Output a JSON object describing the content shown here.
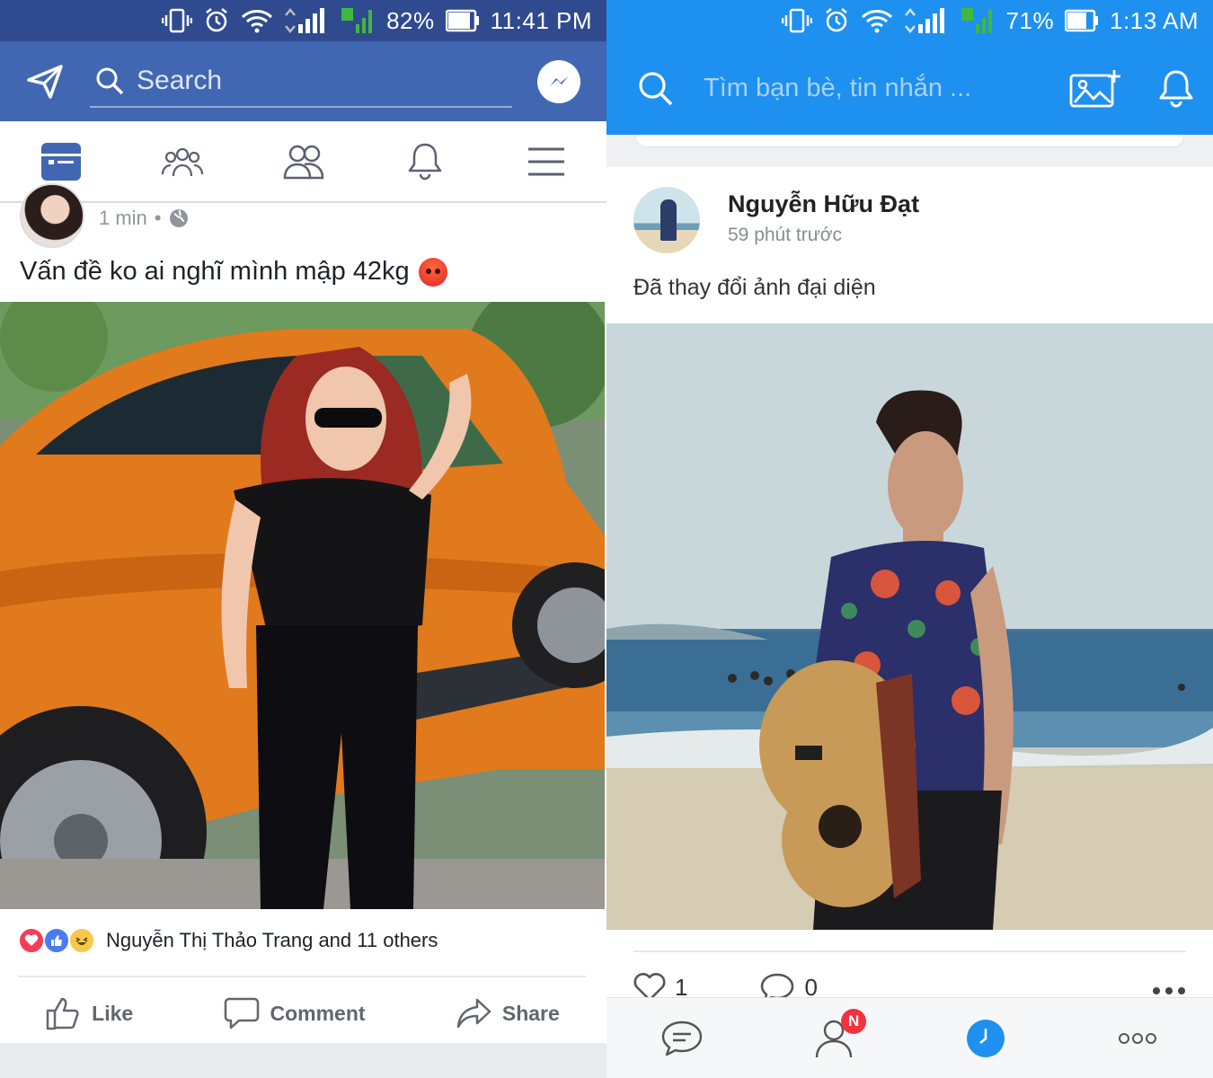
{
  "left": {
    "status": {
      "battery": "82%",
      "time": "11:41 PM",
      "sim_label": "2"
    },
    "header": {
      "search_placeholder": "Search"
    },
    "post": {
      "time": "1 min",
      "separator": "•",
      "caption": "Vấn đề ko ai nghĩ mình mập 42kg",
      "reactions_text": "Nguyễn Thị Thảo Trang and 11 others",
      "actions": {
        "like": "Like",
        "comment": "Comment",
        "share": "Share"
      }
    },
    "colors": {
      "brand": "#4267b2",
      "statusbar": "#2f4a8f"
    }
  },
  "right": {
    "status": {
      "battery": "71%",
      "time": "1:13 AM",
      "sim_label": "2"
    },
    "header": {
      "search_placeholder": "Tìm bạn bè, tin nhắn ..."
    },
    "post": {
      "author": "Nguyễn Hữu Đạt",
      "time": "59 phút trước",
      "caption": "Đã thay đổi ảnh đại diện",
      "likes": "1",
      "comments": "0"
    },
    "nav": {
      "badge": "N"
    },
    "colors": {
      "brand": "#1e90f0"
    }
  }
}
